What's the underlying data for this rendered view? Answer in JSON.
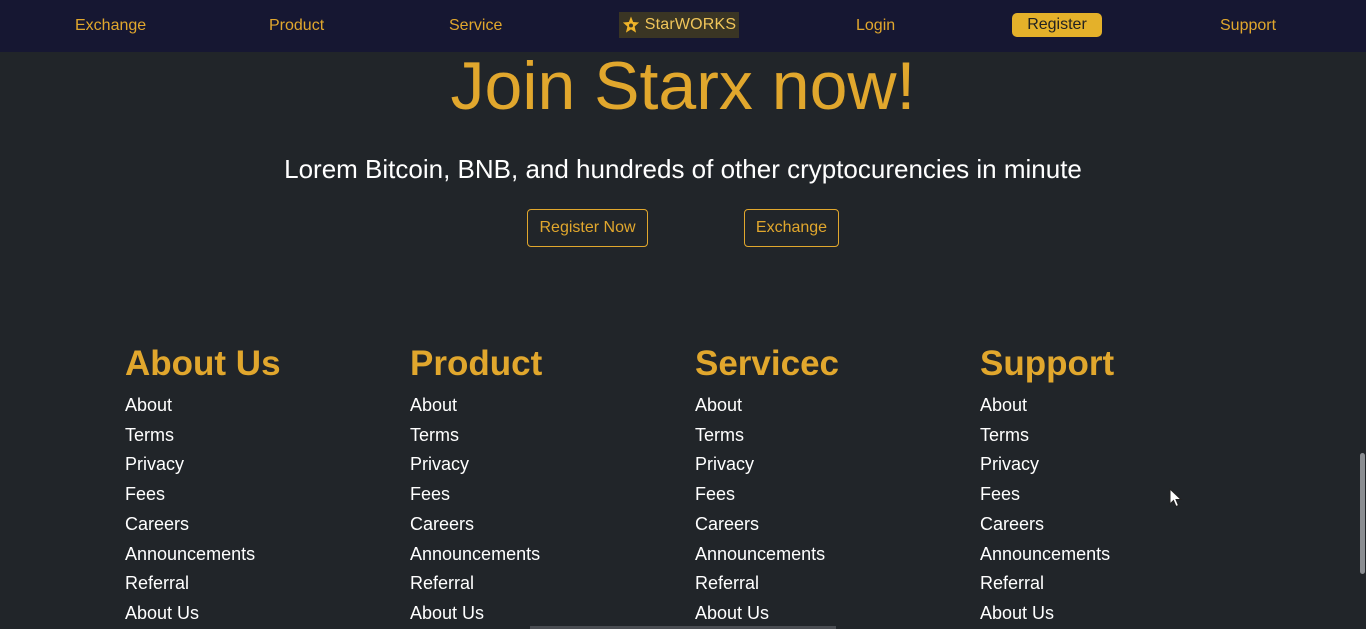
{
  "nav": {
    "exchange": "Exchange",
    "product": "Product",
    "service": "Service",
    "brand": "StarWORKS",
    "login": "Login",
    "register": "Register",
    "support": "Support"
  },
  "hero": {
    "title": "Join Starx now!",
    "subtitle": "Lorem Bitcoin, BNB, and hundreds of other cryptocurencies in minute",
    "register_button": "Register Now",
    "exchange_button": "Exchange"
  },
  "footer": {
    "columns": [
      {
        "title": "About Us",
        "links": [
          "About",
          "Terms",
          "Privacy",
          "Fees",
          "Careers",
          "Announcements",
          "Referral",
          "About Us"
        ]
      },
      {
        "title": "Product",
        "links": [
          "About",
          "Terms",
          "Privacy",
          "Fees",
          "Careers",
          "Announcements",
          "Referral",
          "About Us"
        ]
      },
      {
        "title": "Servicec",
        "links": [
          "About",
          "Terms",
          "Privacy",
          "Fees",
          "Careers",
          "Announcements",
          "Referral",
          "About Us"
        ]
      },
      {
        "title": "Support",
        "links": [
          "About",
          "Terms",
          "Privacy",
          "Fees",
          "Careers",
          "Announcements",
          "Referral",
          "About Us"
        ]
      }
    ]
  },
  "colors": {
    "accent": "#e1a72d",
    "nav_background": "#161732",
    "page_background": "#212529",
    "register_button": "#e4b12a"
  },
  "icons": {
    "brand_logo": "star-icon",
    "cursor": "mouse-pointer-icon"
  }
}
